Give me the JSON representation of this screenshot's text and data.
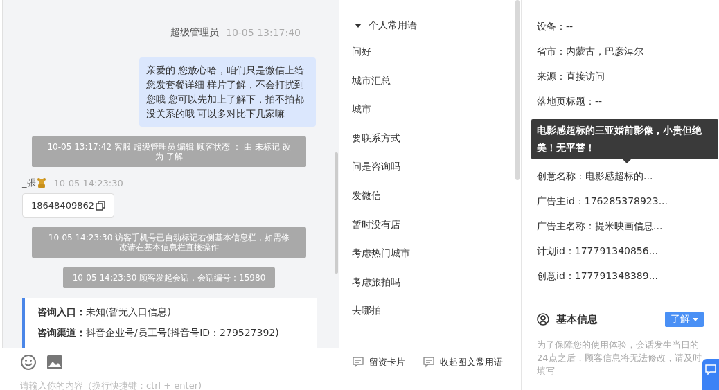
{
  "chat": {
    "messages": [
      {
        "kind": "agent",
        "sender": "超级管理员",
        "time": "10-05 13:17:40",
        "text": "亲爱的 您放心哈，咱们只是微信上给您发套餐详细 样片了解，不会打扰到您哦 您可以先加上了解下，拍不拍都没关系的哦 可以多对比下几家嘛"
      },
      {
        "kind": "system",
        "text": "10-05 13:17:42 客服 超级管理员 编辑 顾客状态 ： 由 未标记 改为 了解"
      },
      {
        "kind": "visitor",
        "sender": "_張",
        "time": "10-05 14:23:30",
        "text": "18648409862"
      },
      {
        "kind": "system",
        "text": "10-05 14:23:30 访客手机号已自动标记右侧基本信息栏，如需修改请在基本信息栏直接操作"
      },
      {
        "kind": "system",
        "text": "10-05 14:23:30 顾客发起会话，会话编号：15980"
      },
      {
        "kind": "info",
        "fields": [
          {
            "label": "咨询入口：",
            "value": "未知(暂无入口信息)"
          },
          {
            "label": "咨询渠道：",
            "value": "抖音企业号/员工号(抖音号ID：279527392)"
          }
        ]
      }
    ]
  },
  "input": {
    "placeholder": "请输入你的内容（换行快捷键：ctrl + enter)"
  },
  "quick_phrases": {
    "group": "个人常用语",
    "expanded": true,
    "items": [
      "问好",
      "城市汇总",
      "城市",
      "要联系方式",
      "问是咨询吗",
      "发微信",
      "暂时没有店",
      "考虑热门城市",
      "考虑旅拍吗",
      "去哪拍"
    ]
  },
  "toolbar": [
    "留资卡片",
    "收起图文常用语"
  ],
  "source_info": {
    "fields_top": [
      {
        "label": "设备：",
        "value": "--"
      },
      {
        "label": "省市：",
        "value": "内蒙古，巴彦淖尔"
      },
      {
        "label": "来源：",
        "value": "直接访问"
      },
      {
        "label": "落地页标题：",
        "value": "--"
      }
    ],
    "tooltip": "电影感超标的三亚婚前影像，小贵但绝美！无平替！",
    "fields": [
      {
        "label": "创意名称：",
        "value": "电影感超标的..."
      },
      {
        "label": "广告主id：",
        "value": "176285378923..."
      },
      {
        "label": "广告主名称：",
        "value": "提米映画信息..."
      },
      {
        "label": "计划id：",
        "value": "177791340856..."
      },
      {
        "label": "创意id：",
        "value": "177791348389..."
      }
    ]
  },
  "basic_info": {
    "title": "基本信息",
    "status": "了解",
    "note": "为了保障您的使用体验，会话发生当日的24点之后，顾客信息将无法修改，请及时填写"
  }
}
